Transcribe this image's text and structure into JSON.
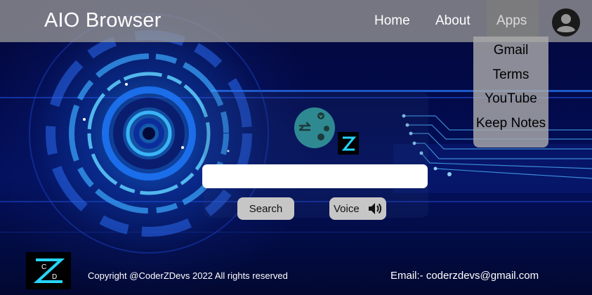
{
  "navbar": {
    "brand": "AIO Browser",
    "links": [
      "Home",
      "About",
      "Apps"
    ],
    "avatar_icon": "user-circle-icon"
  },
  "apps_menu": {
    "items": [
      "Gmail",
      "Terms",
      "YouTube",
      "Keep Notes"
    ]
  },
  "search": {
    "value": "",
    "placeholder": "",
    "search_label": "Search",
    "voice_label": "Voice",
    "voice_icon": "speaker-icon"
  },
  "logos": {
    "center_logo_icon": "share-swap-logo-icon",
    "brand_logo_icon": "coderz-logo-icon",
    "brand_logo_letters": [
      "C",
      "D"
    ]
  },
  "footer": {
    "copyright": "Copyright @CoderZDevs 2022 All rights reserved",
    "email": "Email:- coderzdevs@gmail.com"
  },
  "colors": {
    "navbar": "#969696",
    "accent_blue": "#1fa8ff",
    "button": "#c6c6c6",
    "logo_teal": "#3aa6a0"
  }
}
